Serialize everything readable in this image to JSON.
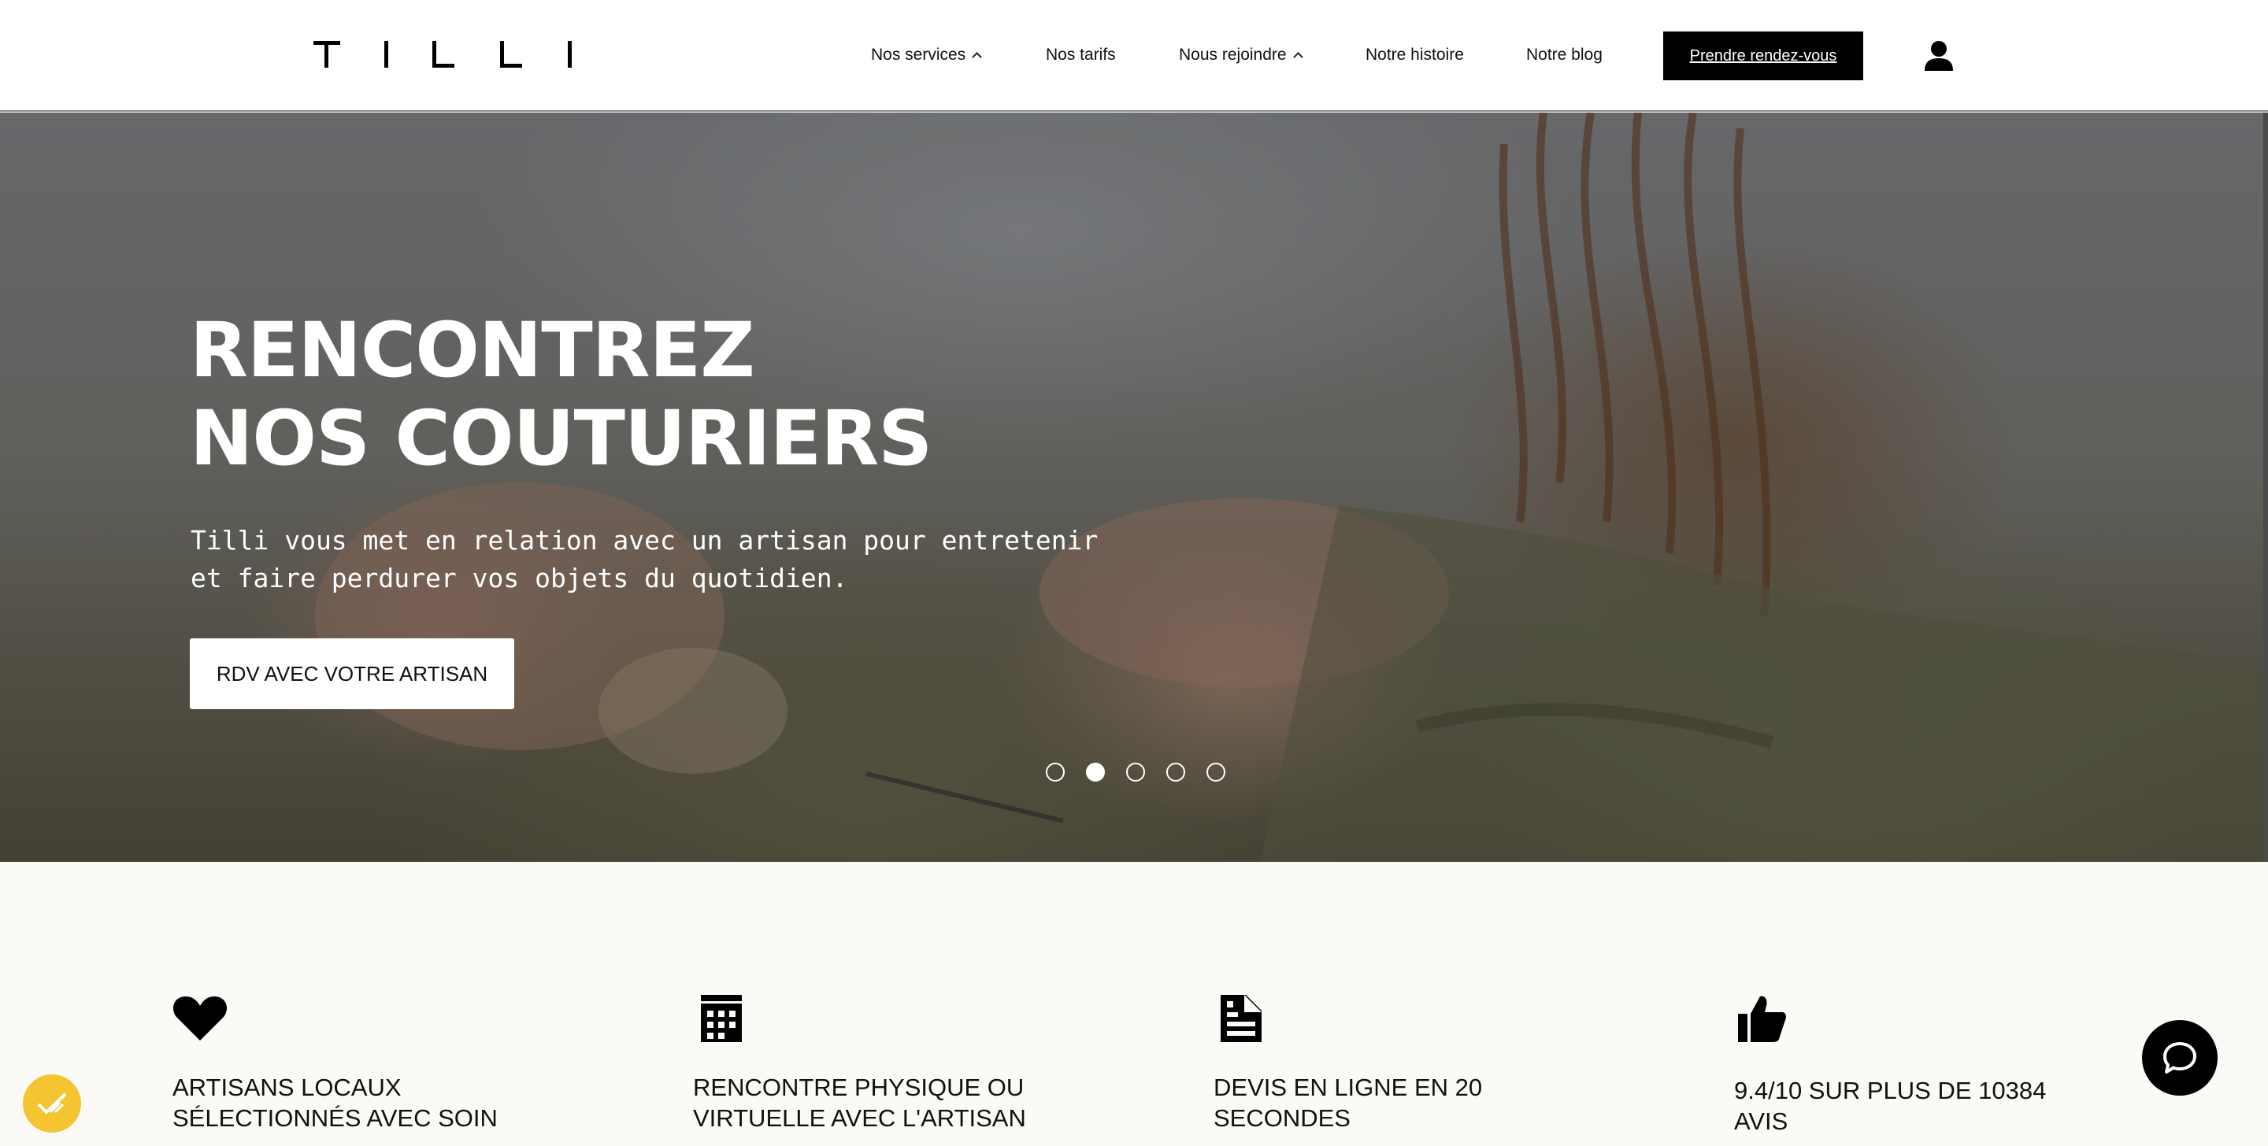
{
  "header": {
    "logo": "TILLI",
    "nav": {
      "services": "Nos services",
      "tarifs": "Nos tarifs",
      "rejoindre": "Nous rejoindre",
      "histoire": "Notre histoire",
      "blog": "Notre blog"
    },
    "cta": "Prendre rendez-vous",
    "account_icon": "user-icon"
  },
  "hero": {
    "title_line1": "RENCONTREZ",
    "title_line2": "NOS COUTURIERS",
    "subtitle_line1": "Tilli vous met en relation avec un artisan pour entretenir",
    "subtitle_line2": "et faire perdurer vos objets du quotidien.",
    "button": "RDV AVEC VOTRE ARTISAN",
    "carousel": {
      "count": 5,
      "active_index": 1
    }
  },
  "features": [
    {
      "icon": "heart-icon",
      "line1": "ARTISANS LOCAUX",
      "line2": "SÉLECTIONNÉS AVEC SOIN"
    },
    {
      "icon": "calendar-icon",
      "line1": "RENCONTRE PHYSIQUE OU",
      "line2": "VIRTUELLE AVEC L'ARTISAN"
    },
    {
      "icon": "document-icon",
      "line1": "DEVIS EN LIGNE EN 20",
      "line2": "SECONDES"
    },
    {
      "icon": "thumbs-up-icon",
      "line1": "9.4/10 SUR PLUS DE 10384",
      "line2": "AVIS"
    }
  ],
  "colors": {
    "accent_yellow": "#f4c531",
    "cta_black": "#000000",
    "section_bg": "#fbfaf6"
  }
}
